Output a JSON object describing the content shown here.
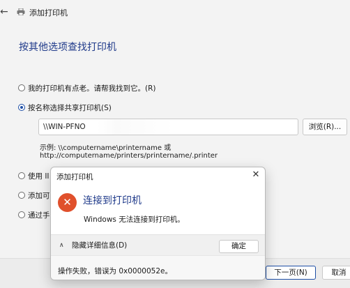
{
  "titlebar": {
    "title": "添加打印机",
    "back_icon": "back-arrow-icon",
    "printer_icon": "printer-icon"
  },
  "heading": "按其他选项查找打印机",
  "options": [
    {
      "label": "我的打印机有点老。请帮我找到它。(R)",
      "selected": false
    },
    {
      "label": "按名称选择共享打印机(S)",
      "selected": true
    },
    {
      "label": "使用 II",
      "selected": false
    },
    {
      "label": "添加可",
      "selected": false
    },
    {
      "label": "通过手",
      "selected": false
    }
  ],
  "share_input": {
    "value": "\\\\WIN-PFNO"
  },
  "browse_label": "浏览(R)...",
  "example_line1": "示例: \\\\computername\\printername 或",
  "example_line2": "http://computername/printers/printername/.printer",
  "next_label": "下一页(N)",
  "cancel_label": "取消",
  "dialog": {
    "title": "添加打印机",
    "close_glyph": "✕",
    "error_glyph": "✕",
    "heading": "连接到打印机",
    "message": "Windows 无法连接到打印机。",
    "details_label": "隐藏详细信息(D)",
    "details_chevron": "∧",
    "ok_label": "确定",
    "detail_text": "操作失败，错误为 0x0000052e。",
    "error_color": "#e0502c"
  }
}
